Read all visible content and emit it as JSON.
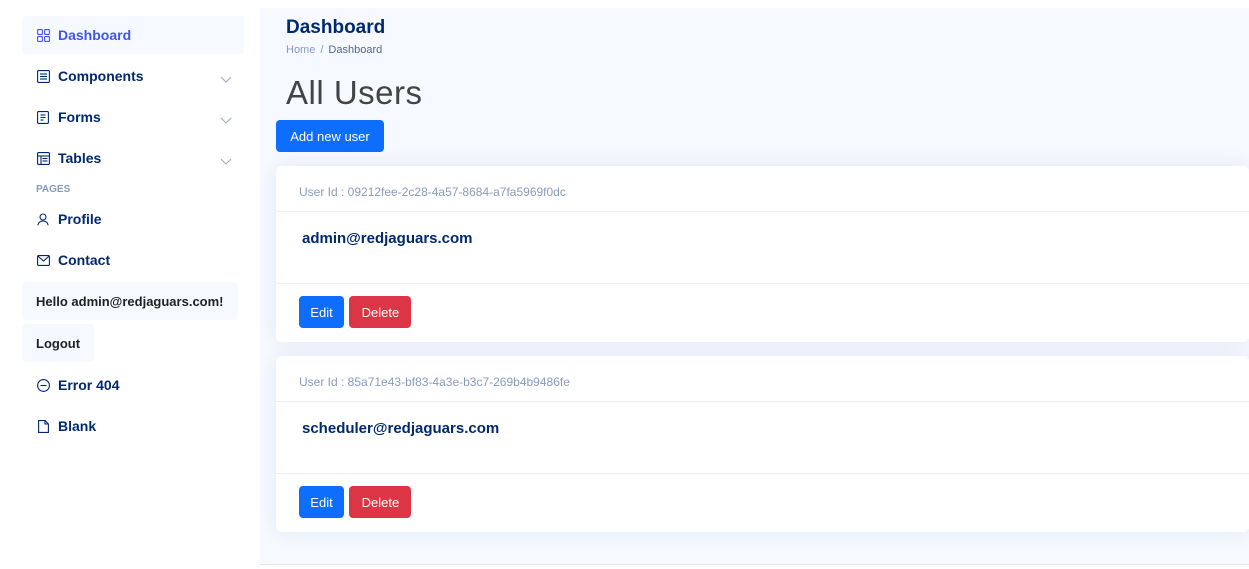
{
  "sidebar": {
    "items": [
      {
        "label": "Dashboard",
        "icon": "grid-icon"
      },
      {
        "label": "Components",
        "icon": "menu-button-icon"
      },
      {
        "label": "Forms",
        "icon": "journal-text-icon"
      },
      {
        "label": "Tables",
        "icon": "layout-text-icon"
      }
    ],
    "heading": "Pages",
    "pages": [
      {
        "label": "Profile",
        "icon": "person-icon"
      },
      {
        "label": "Contact",
        "icon": "envelope-icon"
      }
    ],
    "greeting": "Hello admin@redjaguars.com!",
    "logout": "Logout",
    "extra": [
      {
        "label": "Error 404",
        "icon": "dash-circle-icon"
      },
      {
        "label": "Blank",
        "icon": "file-icon"
      }
    ]
  },
  "header": {
    "title": "Dashboard",
    "breadcrumb_home": "Home",
    "breadcrumb_sep": "/",
    "breadcrumb_current": "Dashboard"
  },
  "main": {
    "heading": "All Users",
    "add_button": "Add new user",
    "users": [
      {
        "id_label": "User Id : 09212fee-2c28-4a57-8684-a7fa5969f0dc",
        "email": "admin@redjaguars.com",
        "edit": "Edit",
        "delete": "Delete"
      },
      {
        "id_label": "User Id : 85a71e43-bf83-4a3e-b3c7-269b4b9486fe",
        "email": "scheduler@redjaguars.com",
        "edit": "Edit",
        "delete": "Delete"
      }
    ]
  },
  "colors": {
    "accent": "#4154f1",
    "primary": "#0d6efd",
    "danger": "#dc3545",
    "navy": "#012970",
    "muted": "#899bbd",
    "background": "#f6f9ff"
  }
}
